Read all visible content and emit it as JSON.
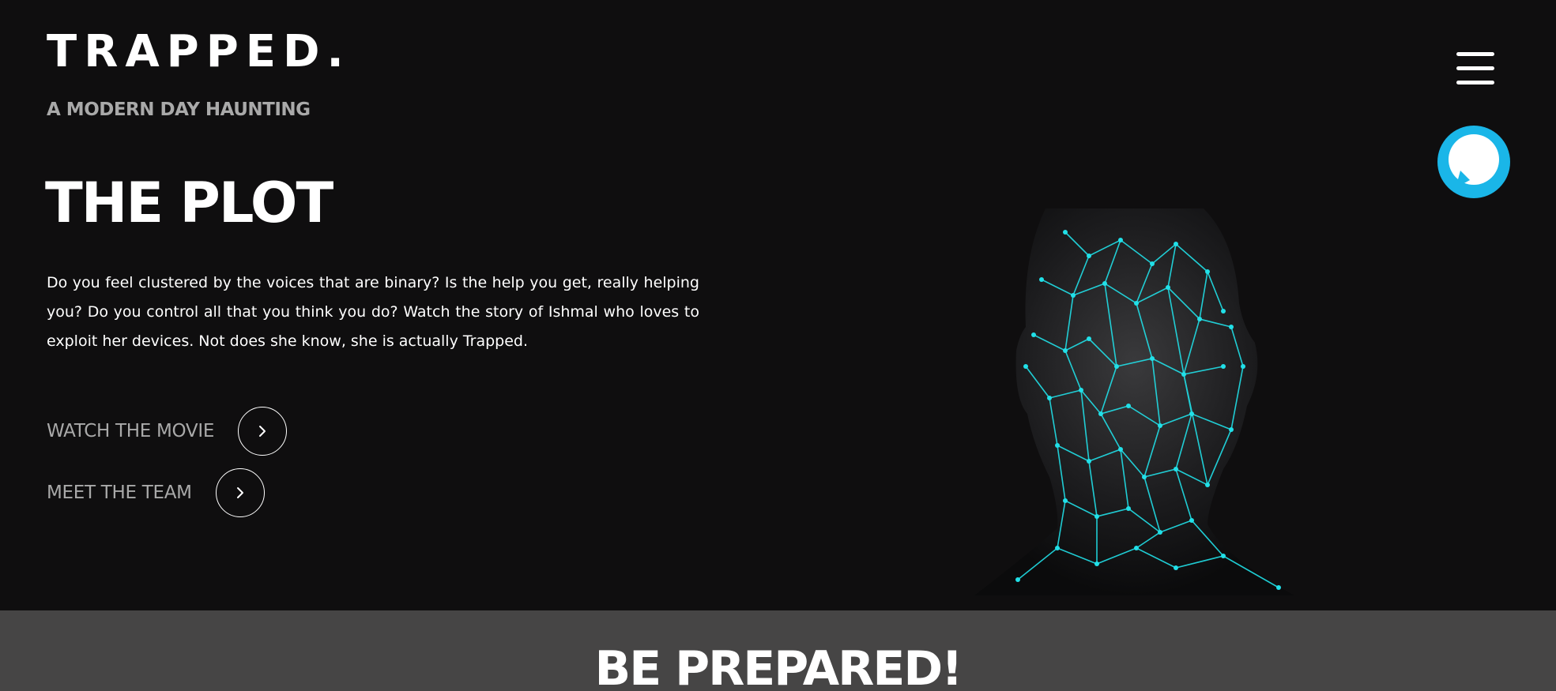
{
  "brand": {
    "logo": "TRAPPED.",
    "tagline": "A MODERN DAY HAUNTING"
  },
  "plot": {
    "title": "THE PLOT",
    "body": "Do you feel clustered by the voices that are binary? Is the help you get, really helping you? Do you control all that you think you do? Watch the story of Ishmal who loves to exploit her devices. Not does she know, she is actually Trapped."
  },
  "actions": {
    "watch_label": "WATCH THE MOVIE",
    "team_label": "MEET THE TEAM",
    "arrow_icon": "chevron-right-icon"
  },
  "header": {
    "menu_icon": "hamburger-menu-icon",
    "assistant_icon": "alexa-icon"
  },
  "next_section": {
    "title": "BE PREPARED!"
  },
  "colors": {
    "background": "#0f0e0f",
    "muted_text": "#a9a9a9",
    "accent_cyan": "#1fd6e6",
    "alexa_blue": "#1ab6e8",
    "section_gray": "#464545"
  }
}
